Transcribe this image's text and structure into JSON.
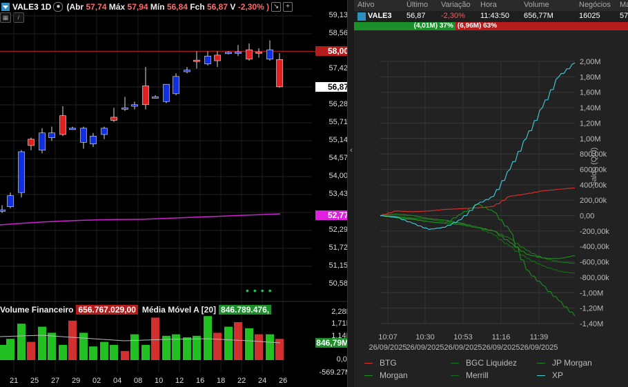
{
  "chart_header": {
    "symbol": "VALE3 1D",
    "abr_label": "(Abr",
    "abr": "57,74",
    "max_label": "Máx",
    "max": "57,94",
    "min_label": "Mín",
    "min": "56,84",
    "fch_label": "Fch",
    "fch": "56,87",
    "var_label": "V",
    "var": "-2,30% )"
  },
  "price_axis": [
    "59,13",
    "58,56",
    "57,42",
    "56,28",
    "55,71",
    "55,14",
    "54,57",
    "54,00",
    "53,43",
    "52,29",
    "51,72",
    "51,15",
    "50,58"
  ],
  "price_labels": {
    "level": "58,00",
    "last": "56,87",
    "ma": "52,77"
  },
  "volume": {
    "title": "Volume Financeiro",
    "value": "656.767.029,00",
    "ma_title": "Média Móvel A [20]",
    "ma_value": "846.789.476,",
    "axis": [
      "2,28B",
      "1,71B",
      "1,14B",
      "",
      "0,00",
      "-569.27M"
    ],
    "ma_label": "846,79M"
  },
  "dates": [
    "21",
    "25",
    "27",
    "29",
    "02",
    "04",
    "08",
    "10",
    "12",
    "16",
    "18",
    "22",
    "24",
    "26"
  ],
  "candles": [
    {
      "o": 52.9,
      "h": 53.1,
      "l": 52.85,
      "c": 52.95,
      "up": true
    },
    {
      "o": 53.05,
      "h": 53.5,
      "l": 53.0,
      "c": 53.4,
      "up": true
    },
    {
      "o": 53.5,
      "h": 54.85,
      "l": 53.35,
      "c": 54.8,
      "up": true
    },
    {
      "o": 55.0,
      "h": 55.25,
      "l": 54.85,
      "c": 55.2,
      "up": false
    },
    {
      "o": 54.85,
      "h": 55.55,
      "l": 54.75,
      "c": 55.4,
      "up": true
    },
    {
      "o": 55.25,
      "h": 55.6,
      "l": 55.15,
      "c": 55.4,
      "up": true
    },
    {
      "o": 55.35,
      "h": 56.25,
      "l": 55.3,
      "c": 55.95,
      "up": false
    },
    {
      "o": 55.55,
      "h": 55.6,
      "l": 55.5,
      "c": 55.52,
      "up": true
    },
    {
      "o": 55.1,
      "h": 55.6,
      "l": 54.9,
      "c": 55.55,
      "up": true
    },
    {
      "o": 55.05,
      "h": 55.4,
      "l": 54.95,
      "c": 55.3,
      "up": true
    },
    {
      "o": 55.35,
      "h": 55.6,
      "l": 55.2,
      "c": 55.55,
      "up": true
    },
    {
      "o": 55.9,
      "h": 56.2,
      "l": 55.75,
      "c": 55.8,
      "up": false
    },
    {
      "o": 56.18,
      "h": 56.55,
      "l": 56.1,
      "c": 56.2,
      "up": true
    },
    {
      "o": 56.3,
      "h": 56.4,
      "l": 56.15,
      "c": 56.25,
      "up": true
    },
    {
      "o": 56.9,
      "h": 57.5,
      "l": 56.15,
      "c": 56.3,
      "up": false
    },
    {
      "o": 56.55,
      "h": 56.6,
      "l": 56.5,
      "c": 56.55,
      "up": true
    },
    {
      "o": 56.4,
      "h": 56.95,
      "l": 56.35,
      "c": 56.95,
      "up": true
    },
    {
      "o": 56.65,
      "h": 57.3,
      "l": 56.6,
      "c": 57.2,
      "up": true
    },
    {
      "o": 57.35,
      "h": 57.5,
      "l": 57.3,
      "c": 57.4,
      "up": true
    },
    {
      "o": 57.7,
      "h": 58.0,
      "l": 57.45,
      "c": 57.72,
      "up": false
    },
    {
      "o": 57.6,
      "h": 58.0,
      "l": 57.55,
      "c": 57.85,
      "up": true
    },
    {
      "o": 57.88,
      "h": 58.0,
      "l": 57.5,
      "c": 57.7,
      "up": false
    },
    {
      "o": 57.95,
      "h": 58.0,
      "l": 57.9,
      "c": 57.97,
      "up": true
    },
    {
      "o": 57.95,
      "h": 58.2,
      "l": 57.85,
      "c": 57.98,
      "up": true
    },
    {
      "o": 58.05,
      "h": 58.25,
      "l": 57.7,
      "c": 57.75,
      "up": false
    },
    {
      "o": 57.95,
      "h": 58.1,
      "l": 57.8,
      "c": 57.98,
      "up": false
    },
    {
      "o": 57.75,
      "h": 58.35,
      "l": 57.7,
      "c": 58.05,
      "up": true
    },
    {
      "o": 57.74,
      "h": 57.94,
      "l": 56.84,
      "c": 56.87,
      "up": false
    }
  ],
  "vol_bars": [
    {
      "v": 0.5,
      "g": true
    },
    {
      "v": 0.7,
      "g": true
    },
    {
      "v": 1.2,
      "g": true
    },
    {
      "v": 0.6,
      "g": false
    },
    {
      "v": 1.1,
      "g": true
    },
    {
      "v": 0.9,
      "g": true
    },
    {
      "v": 0.5,
      "g": true
    },
    {
      "v": 1.3,
      "g": false
    },
    {
      "v": 0.9,
      "g": true
    },
    {
      "v": 0.45,
      "g": true
    },
    {
      "v": 0.6,
      "g": true
    },
    {
      "v": 0.5,
      "g": true
    },
    {
      "v": 0.3,
      "g": false
    },
    {
      "v": 0.85,
      "g": true
    },
    {
      "v": 0.5,
      "g": true
    },
    {
      "v": 1.4,
      "g": false
    },
    {
      "v": 0.8,
      "g": true
    },
    {
      "v": 0.85,
      "g": true
    },
    {
      "v": 0.75,
      "g": true
    },
    {
      "v": 0.8,
      "g": true
    },
    {
      "v": 1.45,
      "g": true
    },
    {
      "v": 0.9,
      "g": false
    },
    {
      "v": 1.1,
      "g": true
    },
    {
      "v": 1.25,
      "g": false
    },
    {
      "v": 1.05,
      "g": true
    },
    {
      "v": 0.85,
      "g": false
    },
    {
      "v": 0.85,
      "g": true
    },
    {
      "v": 0.7,
      "g": false
    }
  ],
  "quote_table": {
    "headers": [
      "Ativo",
      "Último",
      "Variação",
      "Hora",
      "Volume",
      "Negócios",
      "Má"
    ],
    "row": [
      "VALE3",
      "56,87",
      "-2,30%",
      "11:43:50",
      "656,77M",
      "16025",
      "57"
    ],
    "buy_bar": "(4,01M) 37%",
    "sell_bar": "(6,96M) 63%"
  },
  "colors": {
    "up": "#1030e0",
    "down": "#e02020",
    "ma": "#e020e0",
    "green": "#20c020",
    "red_label": "#c62828"
  },
  "chart_data": {
    "type": "line",
    "ylabel": "Saldo (Qtd)",
    "yticks": [
      "2,00M",
      "1,80M",
      "1,60M",
      "1,40M",
      "1,20M",
      "1,00M",
      "800,00k",
      "600,00k",
      "400,00k",
      "200,00k",
      "0,00",
      "-200,00k",
      "-400,00k",
      "-600,00k",
      "-800,00k",
      "-1,00M",
      "-1,20M",
      "-1,40M"
    ],
    "ylim": [
      -1400000,
      2000000
    ],
    "xticks": [
      {
        "t": "10:07",
        "d": "26/09/2025"
      },
      {
        "t": "10:30",
        "d": "26/09/2025"
      },
      {
        "t": "10:53",
        "d": "26/09/2025"
      },
      {
        "t": "11:16",
        "d": "26/09/2025"
      },
      {
        "t": "11:39",
        "d": "26/09/2025"
      }
    ],
    "series": [
      {
        "name": "BTG",
        "color": "#e03030",
        "values": [
          0,
          60000,
          50000,
          60000,
          80000,
          90000,
          100000,
          120000,
          250000,
          280000,
          320000,
          340000,
          360000
        ]
      },
      {
        "name": "BGC Liquidez",
        "color": "#1a7a1a",
        "values": [
          0,
          -20000,
          -40000,
          -80000,
          -100000,
          -120000,
          -160000,
          -200000,
          -300000,
          -450000,
          -550000,
          -600000,
          -620000
        ]
      },
      {
        "name": "JP Morgan",
        "color": "#2a8a2a",
        "values": [
          0,
          20000,
          0,
          -40000,
          -60000,
          -100000,
          -150000,
          -200000,
          -350000,
          -500000,
          -550000,
          -560000,
          -520000
        ]
      },
      {
        "name": "Morgan",
        "color": "#1f8f1f",
        "values": [
          0,
          -30000,
          -50000,
          -80000,
          -100000,
          20000,
          150000,
          50000,
          -200000,
          -700000,
          -900000,
          -1100000,
          -1300000
        ]
      },
      {
        "name": "Merrill",
        "color": "#157015",
        "values": [
          0,
          -10000,
          -30000,
          -50000,
          -80000,
          -110000,
          -150000,
          -250000,
          -400000,
          -550000,
          -650000,
          -720000,
          -750000
        ]
      },
      {
        "name": "XP",
        "color": "#40d0e0",
        "values": [
          0,
          -20000,
          -100000,
          -180000,
          -150000,
          -50000,
          150000,
          250000,
          600000,
          1000000,
          1400000,
          1800000,
          1980000
        ]
      }
    ]
  }
}
